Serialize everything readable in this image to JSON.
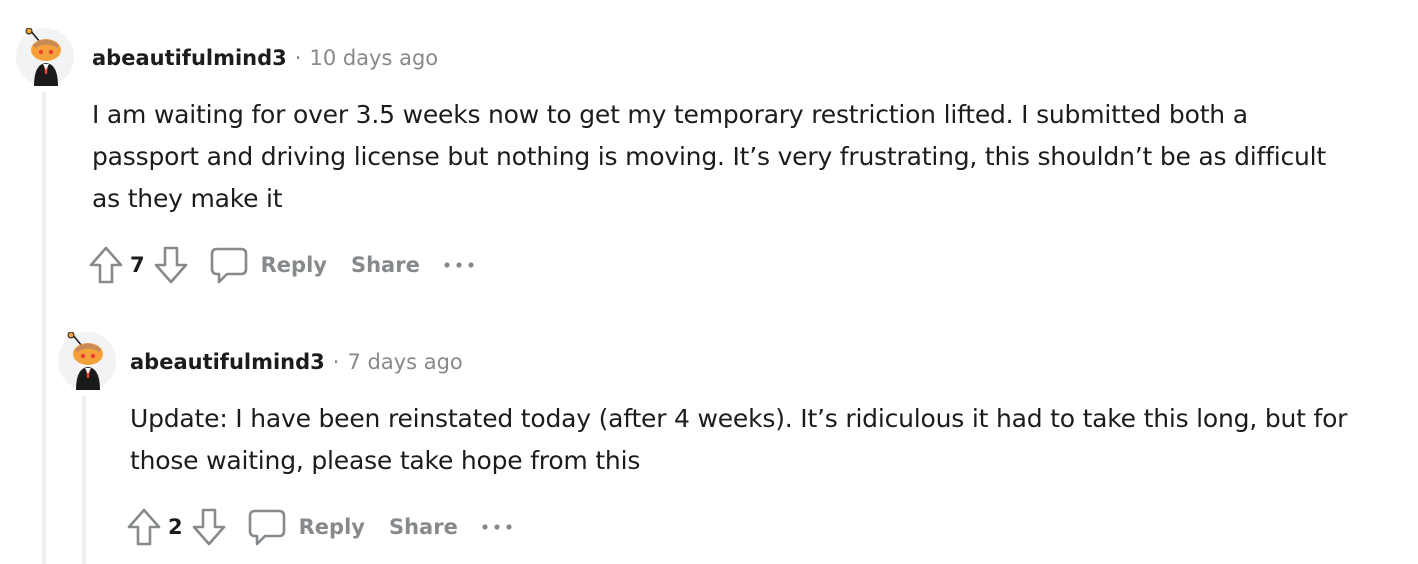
{
  "comments": [
    {
      "author": "abeautifulmind3",
      "separator": "·",
      "time": "10 days ago",
      "body": "I am waiting for over 3.5 weeks now to get my temporary restriction lifted. I submitted both a passport and driving license but nothing is moving. It’s very frustrating, this shouldn’t be as difficult as they make it",
      "score": "7",
      "reply_label": "Reply",
      "share_label": "Share"
    },
    {
      "author": "abeautifulmind3",
      "separator": "·",
      "time": "7 days ago",
      "body": "Update: I have been reinstated today (after 4 weeks). It’s ridiculous it had to take this long, but for those waiting, please take hope from this",
      "score": "2",
      "reply_label": "Reply",
      "share_label": "Share"
    }
  ],
  "icons": {
    "upvote": "upvote-arrow-icon",
    "downvote": "downvote-arrow-icon",
    "reply": "speech-bubble-icon",
    "more": "ellipsis-icon",
    "avatar": "snoo-avatar-icon"
  },
  "colors": {
    "meta_text": "#878a8c",
    "body_text": "#1c1c1c",
    "thread_line": "#edeff1",
    "avatar_orange": "#f4a13a"
  }
}
